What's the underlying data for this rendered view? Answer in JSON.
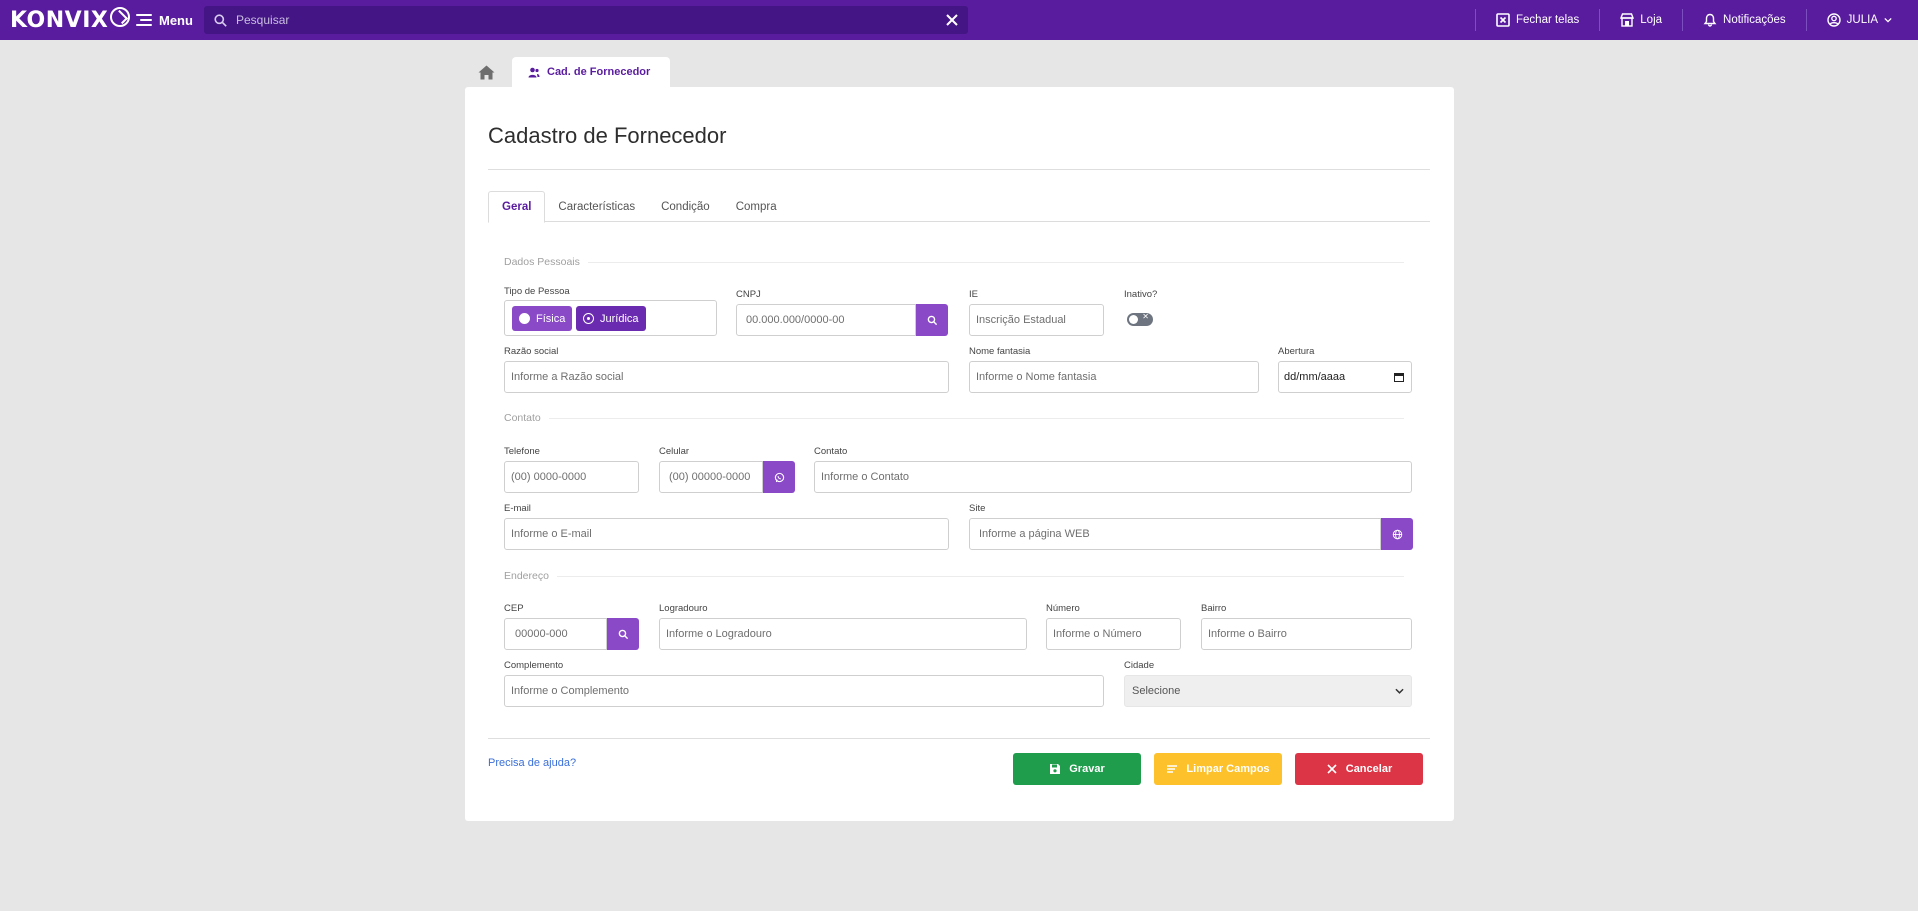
{
  "topbar": {
    "logo_text": "KONVIX",
    "menu_label": "Menu",
    "search_placeholder": "Pesquisar",
    "close_tabs_label": "Fechar telas",
    "store_label": "Loja",
    "notifications_label": "Notificações",
    "user_label": "JULIA"
  },
  "tabs": {
    "doc_tab_label": "Cad. de Fornecedor"
  },
  "page": {
    "title": "Cadastro de Fornecedor",
    "subtabs": [
      "Geral",
      "Características",
      "Condição",
      "Compra"
    ]
  },
  "sections": {
    "personal": "Dados Pessoais",
    "contact": "Contato",
    "address": "Endereço"
  },
  "form": {
    "tipo_pessoa": {
      "label": "Tipo de Pessoa",
      "option_fisica": "Física",
      "option_juridica": "Jurídica",
      "selected": "Jurídica"
    },
    "cnpj": {
      "label": "CNPJ",
      "placeholder": "00.000.000/0000-00"
    },
    "ie": {
      "label": "IE",
      "placeholder": "Inscrição Estadual"
    },
    "inativo": {
      "label": "Inativo?",
      "toggle_off_glyph": "✕"
    },
    "razao_social": {
      "label": "Razão social",
      "placeholder": "Informe a Razão social"
    },
    "nome_fantasia": {
      "label": "Nome fantasia",
      "placeholder": "Informe o Nome fantasia"
    },
    "abertura": {
      "label": "Abertura",
      "value": "dd/mm/aaaa"
    },
    "telefone": {
      "label": "Telefone",
      "placeholder": "(00) 0000-0000"
    },
    "celular": {
      "label": "Celular",
      "placeholder": "(00) 00000-0000"
    },
    "contato": {
      "label": "Contato",
      "placeholder": "Informe o Contato"
    },
    "email": {
      "label": "E-mail",
      "placeholder": "Informe o E-mail"
    },
    "site": {
      "label": "Site",
      "placeholder": "Informe a página WEB"
    },
    "cep": {
      "label": "CEP",
      "placeholder": "00000-000"
    },
    "logradouro": {
      "label": "Logradouro",
      "placeholder": "Informe o Logradouro"
    },
    "numero": {
      "label": "Número",
      "placeholder": "Informe o Número"
    },
    "bairro": {
      "label": "Bairro",
      "placeholder": "Informe o Bairro"
    },
    "complemento": {
      "label": "Complemento",
      "placeholder": "Informe o Complemento"
    },
    "cidade": {
      "label": "Cidade",
      "value": "Selecione"
    }
  },
  "footer": {
    "help_link": "Precisa de ajuda?",
    "save_label": "Gravar",
    "clear_label": "Limpar Campos",
    "cancel_label": "Cancelar"
  },
  "colors": {
    "brand": "#5a1c9f",
    "accent_button": "#8a49c7",
    "save": "#1f9d4c",
    "clear": "#fcc12b",
    "cancel": "#dc3545"
  },
  "icons": [
    "menu-icon",
    "search-icon",
    "close-icon",
    "close-tabs-icon",
    "store-icon",
    "bell-icon",
    "user-circle-icon",
    "chevron-down-icon",
    "home-icon",
    "users-icon",
    "whatsapp-icon",
    "globe-icon",
    "calendar-icon",
    "save-icon",
    "clear-icon",
    "cancel-icon"
  ]
}
